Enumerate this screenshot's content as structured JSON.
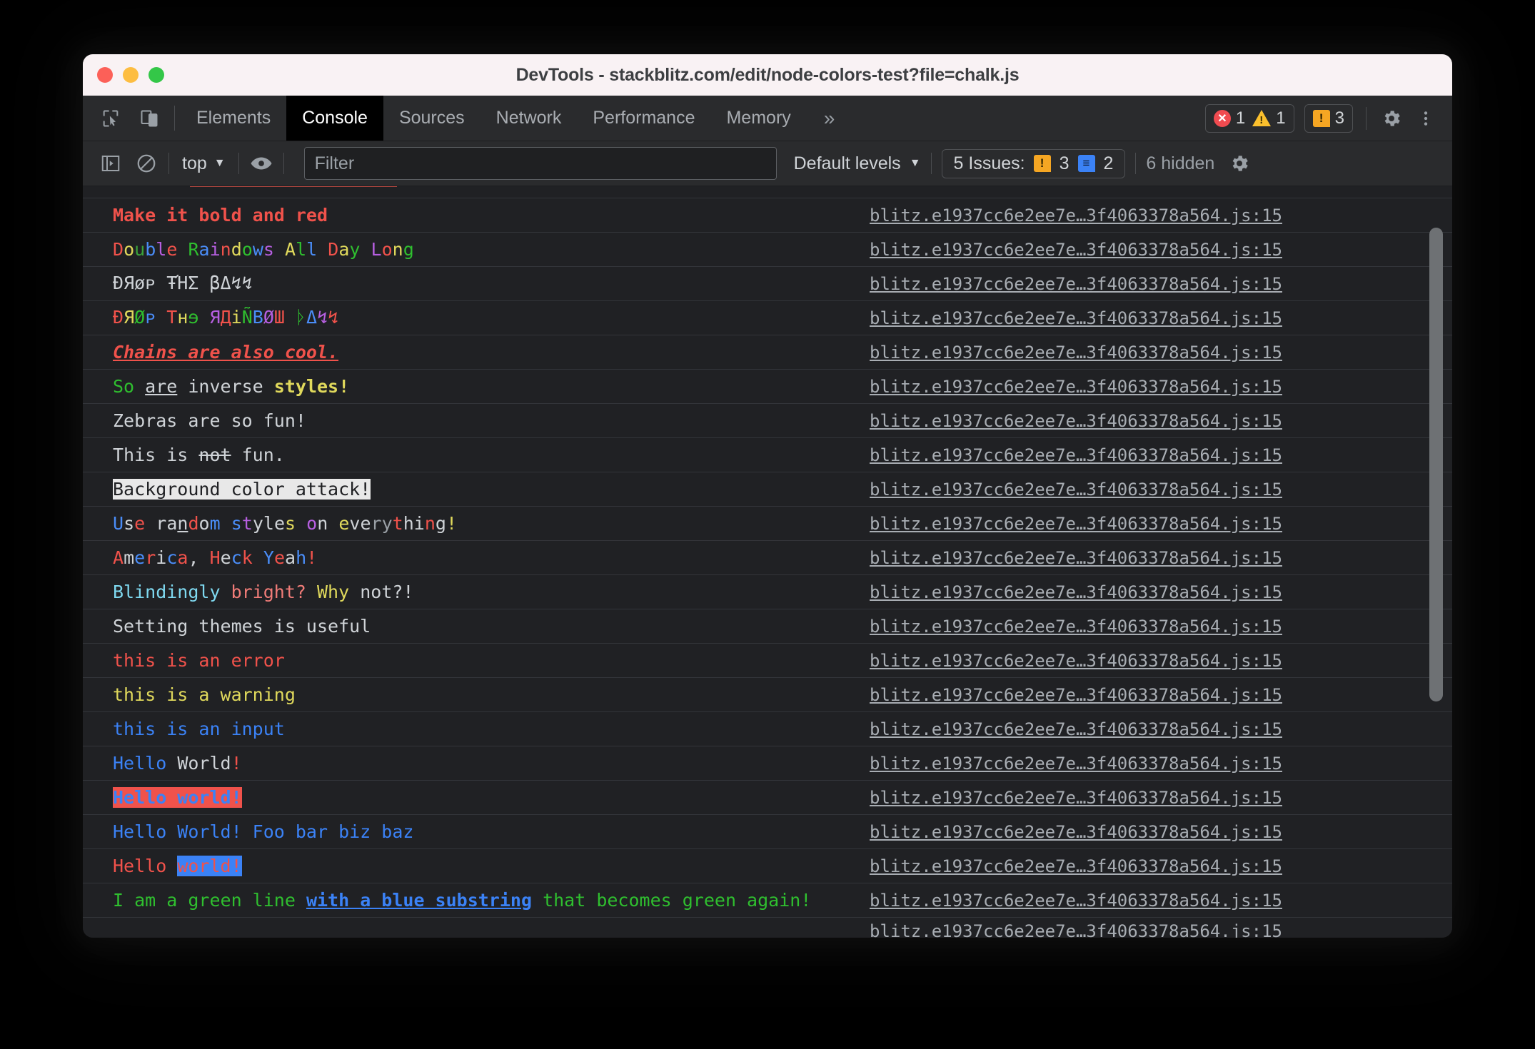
{
  "window": {
    "title": "DevTools - stackblitz.com/edit/node-colors-test?file=chalk.js"
  },
  "tabbar": {
    "icons": [
      "inspect-element-icon",
      "device-toolbar-icon"
    ],
    "tabs": [
      {
        "label": "Elements",
        "active": false
      },
      {
        "label": "Console",
        "active": true
      },
      {
        "label": "Sources",
        "active": false
      },
      {
        "label": "Network",
        "active": false
      },
      {
        "label": "Performance",
        "active": false
      },
      {
        "label": "Memory",
        "active": false
      }
    ],
    "more_label": "»",
    "error_count": "1",
    "warning_count": "1",
    "issue_count": "3",
    "settings_icon": "gear-icon",
    "menu_icon": "kebab-menu-icon"
  },
  "filterbar": {
    "sidebar_toggle": "console-sidebar-icon",
    "clear_console": "clear-console-icon",
    "context_label": "top",
    "context_caret": "▼",
    "eye_icon": "live-expression-icon",
    "filter_placeholder": "Filter",
    "filter_value": "",
    "levels_label": "Default levels",
    "levels_caret": "▼",
    "issues_label": "5 Issues:",
    "issues_orange_count": "3",
    "issues_blue_count": "2",
    "hidden_label": "6 hidden",
    "settings_icon": "gear-icon"
  },
  "console": {
    "source_link": "blitz.e1937cc6e2ee7e…3f4063378a564.js:15",
    "messages": [
      {
        "name": "msg-bold-red",
        "segments": [
          {
            "t": "Make it bold and red",
            "c": "#f0524b",
            "s": "b"
          }
        ]
      },
      {
        "name": "msg-double-rainbow",
        "segments": [
          {
            "t": "D",
            "c": "#f0524b"
          },
          {
            "t": "o",
            "c": "#e0d95c"
          },
          {
            "t": "u",
            "c": "#3aa33a"
          },
          {
            "t": "b",
            "c": "#4a8df8"
          },
          {
            "t": "l",
            "c": "#b65fe0"
          },
          {
            "t": "e",
            "c": "#f0524b"
          },
          {
            "t": " ",
            "c": "#cfd3d7"
          },
          {
            "t": "R",
            "c": "#2fbf2f"
          },
          {
            "t": "a",
            "c": "#4a8df8"
          },
          {
            "t": "i",
            "c": "#b65fe0"
          },
          {
            "t": "n",
            "c": "#f0524b"
          },
          {
            "t": "d",
            "c": "#e0d95c"
          },
          {
            "t": "o",
            "c": "#2fbf2f"
          },
          {
            "t": "w",
            "c": "#4a8df8"
          },
          {
            "t": "s",
            "c": "#b65fe0"
          },
          {
            "t": " ",
            "c": "#cfd3d7"
          },
          {
            "t": "A",
            "c": "#e0d95c"
          },
          {
            "t": "l",
            "c": "#2fbf2f"
          },
          {
            "t": "l",
            "c": "#4a8df8"
          },
          {
            "t": " ",
            "c": "#cfd3d7"
          },
          {
            "t": "D",
            "c": "#f0524b"
          },
          {
            "t": "a",
            "c": "#e0d95c"
          },
          {
            "t": "y",
            "c": "#2fbf2f"
          },
          {
            "t": " ",
            "c": "#cfd3d7"
          },
          {
            "t": "L",
            "c": "#b65fe0"
          },
          {
            "t": "o",
            "c": "#f0524b"
          },
          {
            "t": "n",
            "c": "#e0d95c"
          },
          {
            "t": "g",
            "c": "#2fbf2f"
          }
        ]
      },
      {
        "name": "msg-drop-the-bass",
        "segments": [
          {
            "t": "ÐЯøᴩ ŦΉΣ βΔ↯↯",
            "c": "#cfd3d7"
          }
        ]
      },
      {
        "name": "msg-drop-the-rainbow-bass",
        "segments": [
          {
            "t": "Ð",
            "c": "#f0524b"
          },
          {
            "t": "Я",
            "c": "#e0d95c"
          },
          {
            "t": "Ø",
            "c": "#2fbf2f"
          },
          {
            "t": "ᴩ",
            "c": "#4a8df8"
          },
          {
            "t": " ",
            "c": "#cfd3d7"
          },
          {
            "t": "T",
            "c": "#f0524b"
          },
          {
            "t": "н",
            "c": "#e0d95c"
          },
          {
            "t": "ɘ",
            "c": "#2fbf2f"
          },
          {
            "t": " ",
            "c": "#cfd3d7"
          },
          {
            "t": "Я",
            "c": "#b65fe0"
          },
          {
            "t": "Д",
            "c": "#f0524b"
          },
          {
            "t": "i",
            "c": "#e0d95c"
          },
          {
            "t": "Ñ",
            "c": "#2fbf2f"
          },
          {
            "t": "B",
            "c": "#4a8df8"
          },
          {
            "t": "Ø",
            "c": "#b65fe0"
          },
          {
            "t": "Ш",
            "c": "#f0524b"
          },
          {
            "t": " ",
            "c": "#cfd3d7"
          },
          {
            "t": "ᚦ",
            "c": "#2fbf2f"
          },
          {
            "t": "Δ",
            "c": "#4a8df8"
          },
          {
            "t": "↯",
            "c": "#b65fe0"
          },
          {
            "t": "↯",
            "c": "#f0524b"
          }
        ]
      },
      {
        "name": "msg-chains",
        "segments": [
          {
            "t": "Chains are also cool.",
            "c": "#f0524b",
            "s": "biu"
          }
        ]
      },
      {
        "name": "msg-inverse-styles",
        "segments": [
          {
            "t": "So",
            "c": "#2fbf2f"
          },
          {
            "t": " ",
            "c": "#cfd3d7"
          },
          {
            "t": "are",
            "c": "#cfd3d7",
            "s": "u"
          },
          {
            "t": " inverse ",
            "c": "#cfd3d7"
          },
          {
            "t": "styles!",
            "c": "#e0d95c",
            "s": "b"
          }
        ]
      },
      {
        "name": "msg-zebras",
        "segments": [
          {
            "t": "Zebras are so fun!",
            "c": "#cfd3d7"
          }
        ]
      },
      {
        "name": "msg-not-fun",
        "segments": [
          {
            "t": "This is ",
            "c": "#cfd3d7"
          },
          {
            "t": "not",
            "c": "#cfd3d7",
            "s": "s"
          },
          {
            "t": " fun.",
            "c": "#cfd3d7"
          }
        ]
      },
      {
        "name": "msg-background-attack",
        "segments": [
          {
            "t": "Background color attack!",
            "c": "#202124",
            "bg": "#e8e8e8"
          }
        ]
      },
      {
        "name": "msg-random-styles",
        "segments": [
          {
            "t": "U",
            "c": "#4a8df8"
          },
          {
            "t": "s",
            "c": "#cfd3d7"
          },
          {
            "t": "e",
            "c": "#f0524b"
          },
          {
            "t": " ",
            "c": "#cfd3d7"
          },
          {
            "t": "r",
            "c": "#cfd3d7"
          },
          {
            "t": "a",
            "c": "#cfd3d7"
          },
          {
            "t": "n",
            "c": "#cfd3d7",
            "s": "u"
          },
          {
            "t": "d",
            "c": "#f0524b"
          },
          {
            "t": "o",
            "c": "#cfd3d7"
          },
          {
            "t": "m",
            "c": "#4a8df8"
          },
          {
            "t": " ",
            "c": "#cfd3d7"
          },
          {
            "t": "s",
            "c": "#4a8df8"
          },
          {
            "t": "t",
            "c": "#b65fe0"
          },
          {
            "t": "y",
            "c": "#cfd3d7"
          },
          {
            "t": "l",
            "c": "#cfd3d7"
          },
          {
            "t": "e",
            "c": "#cfd3d7"
          },
          {
            "t": "s",
            "c": "#e0d95c"
          },
          {
            "t": " ",
            "c": "#cfd3d7"
          },
          {
            "t": "o",
            "c": "#b65fe0"
          },
          {
            "t": "n",
            "c": "#cfd3d7"
          },
          {
            "t": " ",
            "c": "#cfd3d7"
          },
          {
            "t": "e",
            "c": "#e0d95c"
          },
          {
            "t": "v",
            "c": "#cfd3d7"
          },
          {
            "t": "e",
            "c": "#cfd3d7"
          },
          {
            "t": "r",
            "c": "#9aa0a6"
          },
          {
            "t": "y",
            "c": "#9aa0a6"
          },
          {
            "t": "t",
            "c": "#f0524b"
          },
          {
            "t": "h",
            "c": "#cfd3d7"
          },
          {
            "t": "i",
            "c": "#cfd3d7"
          },
          {
            "t": "n",
            "c": "#f0524b"
          },
          {
            "t": "g",
            "c": "#cfd3d7"
          },
          {
            "t": "!",
            "c": "#e0d95c"
          }
        ]
      },
      {
        "name": "msg-america",
        "segments": [
          {
            "t": "A",
            "c": "#f0524b"
          },
          {
            "t": "m",
            "c": "#cfd3d7"
          },
          {
            "t": "e",
            "c": "#4a8df8"
          },
          {
            "t": "r",
            "c": "#f0524b"
          },
          {
            "t": "i",
            "c": "#cfd3d7"
          },
          {
            "t": "c",
            "c": "#4a8df8"
          },
          {
            "t": "a",
            "c": "#f0524b"
          },
          {
            "t": ",",
            "c": "#cfd3d7"
          },
          {
            "t": " ",
            "c": "#cfd3d7"
          },
          {
            "t": "H",
            "c": "#f0524b"
          },
          {
            "t": "e",
            "c": "#cfd3d7"
          },
          {
            "t": "c",
            "c": "#4a8df8"
          },
          {
            "t": "k",
            "c": "#f0524b"
          },
          {
            "t": " ",
            "c": "#cfd3d7"
          },
          {
            "t": "Y",
            "c": "#4a8df8"
          },
          {
            "t": "e",
            "c": "#f0524b"
          },
          {
            "t": "a",
            "c": "#cfd3d7"
          },
          {
            "t": "h",
            "c": "#4a8df8"
          },
          {
            "t": "!",
            "c": "#f0524b"
          }
        ]
      },
      {
        "name": "msg-blindingly-bright",
        "segments": [
          {
            "t": "Blindingly",
            "c": "#7fd9f0"
          },
          {
            "t": " ",
            "c": "#cfd3d7"
          },
          {
            "t": "bright?",
            "c": "#f07c78"
          },
          {
            "t": " ",
            "c": "#cfd3d7"
          },
          {
            "t": "Why",
            "c": "#e0d95c"
          },
          {
            "t": " ",
            "c": "#cfd3d7"
          },
          {
            "t": "not?!",
            "c": "#cfd3d7"
          }
        ]
      },
      {
        "name": "msg-themes",
        "segments": [
          {
            "t": "Setting themes is useful",
            "c": "#cfd3d7"
          }
        ]
      },
      {
        "name": "msg-error",
        "segments": [
          {
            "t": "this is an error",
            "c": "#f0524b"
          }
        ]
      },
      {
        "name": "msg-warning",
        "segments": [
          {
            "t": "this is a warning",
            "c": "#e0d95c"
          }
        ]
      },
      {
        "name": "msg-input",
        "segments": [
          {
            "t": "this is an input",
            "c": "#3b82f6"
          }
        ]
      },
      {
        "name": "msg-hello-world",
        "segments": [
          {
            "t": "Hello",
            "c": "#3b82f6"
          },
          {
            "t": " ",
            "c": "#cfd3d7"
          },
          {
            "t": "World",
            "c": "#cfd3d7"
          },
          {
            "t": "!",
            "c": "#f0524b"
          }
        ]
      },
      {
        "name": "msg-hello-world-redbg",
        "segments": [
          {
            "t": "Hello world!",
            "c": "#3b82f6",
            "bg": "#f0524b",
            "s": "b"
          }
        ]
      },
      {
        "name": "msg-hello-world-foo-bar",
        "segments": [
          {
            "t": "Hello World! Foo bar biz baz",
            "c": "#3b82f6"
          }
        ]
      },
      {
        "name": "msg-hello-world-bluebg",
        "segments": [
          {
            "t": "Hello ",
            "c": "#f0524b"
          },
          {
            "t": "world!",
            "c": "#f0524b",
            "bg": "#3b82f6"
          }
        ]
      },
      {
        "name": "msg-green-line-blue-substring",
        "segments": [
          {
            "t": "I am a green line ",
            "c": "#2fbf2f"
          },
          {
            "t": "with a blue substring",
            "c": "#3b82f6",
            "s": "bu"
          },
          {
            "t": " that becomes green again!",
            "c": "#2fbf2f"
          }
        ]
      }
    ]
  }
}
